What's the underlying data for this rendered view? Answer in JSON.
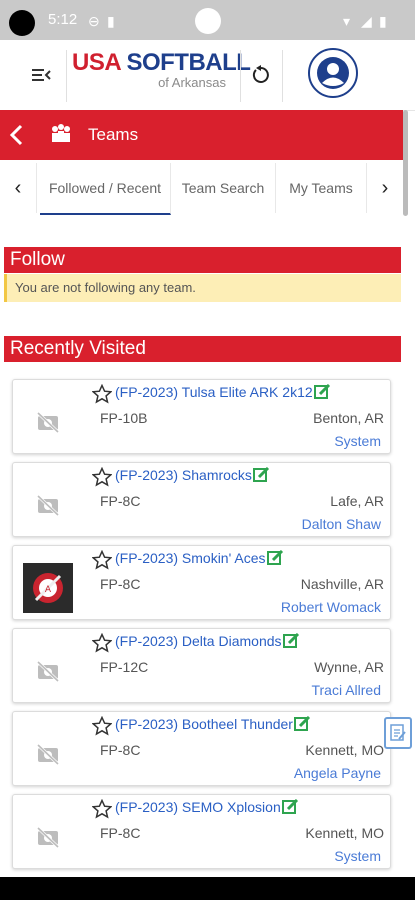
{
  "statusbar": {
    "time": "5:12"
  },
  "header": {
    "logo_line1_usa": "USA",
    "logo_line1_softball": " SOFTBALL",
    "logo_line2": "of Arkansas",
    "menu_icon": "menu-collapse-icon",
    "refresh_icon": "refresh-icon",
    "profile_icon": "account-icon"
  },
  "titlebar": {
    "title": "Teams"
  },
  "tabs": [
    {
      "label": "Followed / Recent",
      "active": true
    },
    {
      "label": "Team Search",
      "active": false
    },
    {
      "label": "My Teams",
      "active": false
    }
  ],
  "follow": {
    "heading": "Follow",
    "notice": "You are not following any team."
  },
  "recent": {
    "heading": "Recently Visited",
    "teams": [
      {
        "name": "(FP-2023) Tulsa Elite ARK 2k12",
        "division": "FP-10B",
        "location": "Benton, AR",
        "owner": "System",
        "has_photo": false
      },
      {
        "name": "(FP-2023) Shamrocks",
        "division": "FP-8C",
        "location": "Lafe, AR",
        "owner": "Dalton Shaw",
        "has_photo": false
      },
      {
        "name": "(FP-2023) Smokin' Aces",
        "division": "FP-8C",
        "location": "Nashville, AR",
        "owner": "Robert Womack",
        "has_photo": true
      },
      {
        "name": "(FP-2023) Delta Diamonds",
        "division": "FP-12C",
        "location": "Wynne, AR",
        "owner": "Traci Allred",
        "has_photo": false
      },
      {
        "name": "(FP-2023) Bootheel Thunder",
        "division": "FP-8C",
        "location": "Kennett, MO",
        "owner": "Angela Payne",
        "has_photo": false
      },
      {
        "name": "(FP-2023) SEMO Xplosion",
        "division": "FP-8C",
        "location": "Kennett, MO",
        "owner": "System",
        "has_photo": false
      }
    ]
  },
  "colors": {
    "brand_red": "#d9202d",
    "brand_blue": "#1e3f8c",
    "link_blue": "#2a5fc4"
  }
}
